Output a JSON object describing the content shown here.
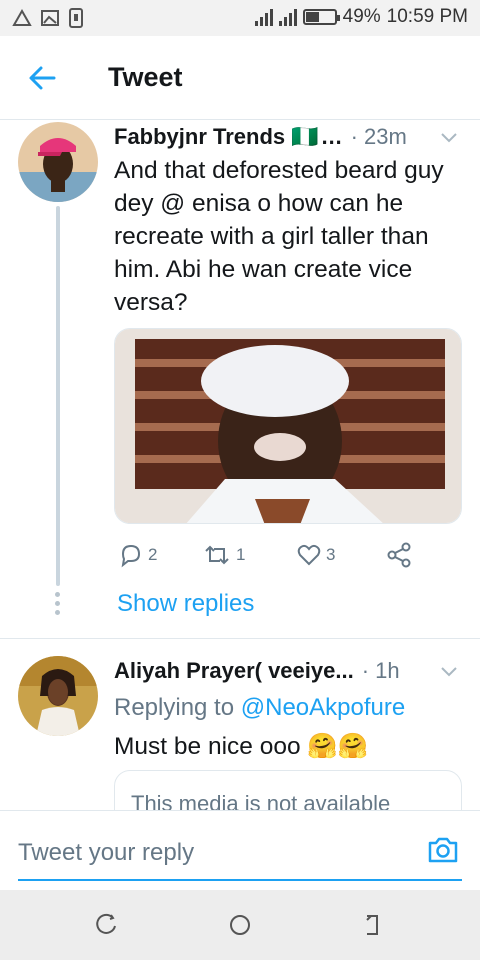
{
  "status_bar": {
    "battery": "49%",
    "battery_level": 0.49,
    "time": "10:59 PM"
  },
  "header": {
    "title": "Tweet"
  },
  "tweets": [
    {
      "name": "Fabbyjnr Trends",
      "flag": "🇳🇬",
      "time": "· 23m",
      "text": "And that deforested beard guy dey @ enisa o how can he recreate with a girl taller than him. Abi he wan create vice versa?",
      "reply_count": "2",
      "retweet_count": "1",
      "like_count": "3",
      "show_replies": "Show replies"
    },
    {
      "name": "Aliyah Prayer( veeiye...",
      "time": "· 1h",
      "replying_label": "Replying to",
      "replying_handle": "@NeoAkpofure",
      "text": "Must be nice ooo 🤗🤗",
      "media_unavailable": "This media is not available"
    }
  ],
  "reply_bar": {
    "placeholder": "Tweet your reply"
  },
  "colors": {
    "accent": "#1da1f2",
    "secondary_text": "#657786",
    "border": "#e1e8ed"
  },
  "icons": [
    "back-arrow-icon",
    "chevron-down-icon",
    "reply-icon",
    "retweet-icon",
    "like-icon",
    "share-icon",
    "camera-icon",
    "recents-icon",
    "home-icon",
    "back-nav-icon"
  ]
}
